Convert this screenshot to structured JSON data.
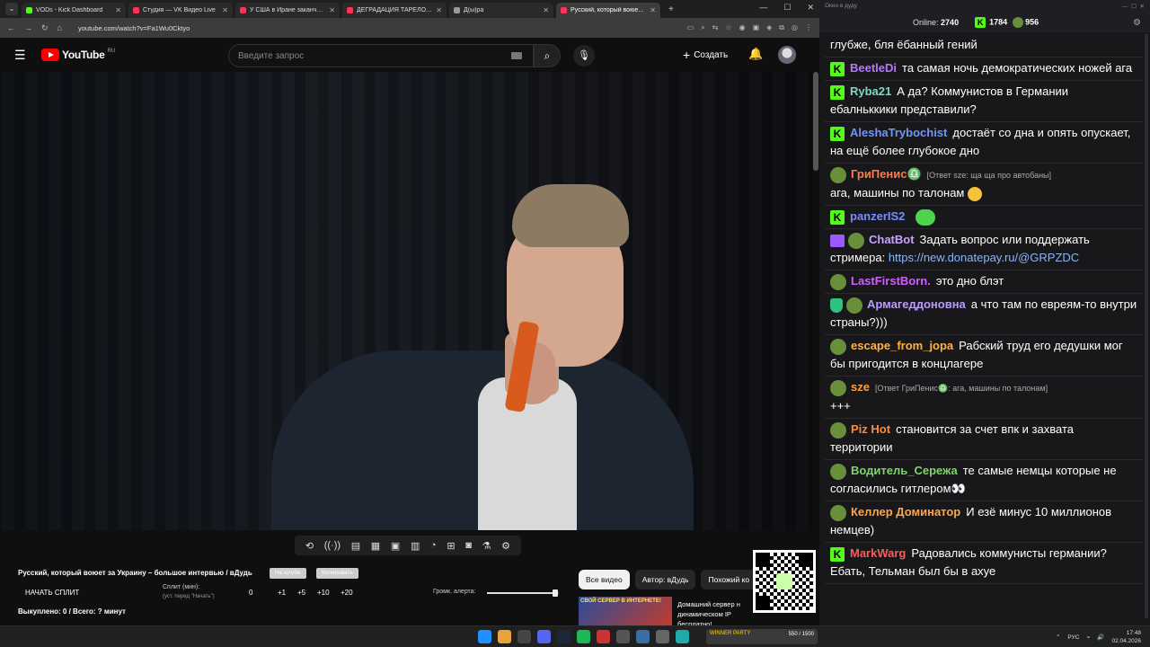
{
  "browser": {
    "tabs": [
      {
        "title": "VODs - Kick Dashboard",
        "color": "#53fc18",
        "active": false
      },
      {
        "title": "Студия — VK Видео Live",
        "color": "#ff3355",
        "active": false
      },
      {
        "title": "У США в Иране заканчиваютс",
        "color": "#ff3355",
        "active": false
      },
      {
        "title": "ДЕГРАДАЦИЯ ТАРЕЛОЧНИЦ",
        "color": "#ff3355",
        "active": false
      },
      {
        "title": "Д(ы)ра",
        "color": "#999999",
        "active": false
      },
      {
        "title": "Русский, который воюет за",
        "color": "#ff3355",
        "active": true
      }
    ],
    "url": "youtube.com/watch?v=Fa1Wu0Cktyo"
  },
  "youtube": {
    "logo_word": "YouTube",
    "logo_region": "RU",
    "search_placeholder": "Введите запрос",
    "create_label": "Создать"
  },
  "video": {
    "title": "Русский, который воюет за Украину – большое интервью / вДудь",
    "btn_on_youtube": "На ютубе",
    "btn_copy": "Копировать",
    "split_button": "НАЧАТЬ СПЛИТ",
    "split_label": "Сплит (мин):",
    "split_sub": "(уст. перед \"Начать\")",
    "split_values": [
      "0",
      "+1",
      "+5",
      "+10",
      "+20"
    ],
    "bought_text": "Выкуплено: 0 / Всего: ? минут",
    "alert_label": "Громк. алерта:",
    "alert_volume": 0.95
  },
  "recs": {
    "chips": [
      "Все видео",
      "Автор: вДудь",
      "Похожий ко"
    ],
    "thumb_text": "СВОЙ СЕРВЕР В ИНТЕРНЕТЕ!",
    "title": "Домашний сервер н динамическом IP бесплатно!..."
  },
  "chat": {
    "window_title": "Окно в дуду",
    "online_label": "Online:",
    "online_count": "2740",
    "kick_count": "1784",
    "other_count": "956",
    "messages": [
      {
        "badge": "none",
        "user": "",
        "color": "#ffffff",
        "reply": "",
        "text": "глубже, бля ёбанный гений"
      },
      {
        "badge": "kick",
        "user": "BeetleDi",
        "color": "#b478ff",
        "reply": "",
        "text": "та самая ночь демократических ножей ага"
      },
      {
        "badge": "kick",
        "user": "Ryba21",
        "color": "#7fd6c9",
        "reply": "",
        "text": "А да? Коммунистов в Германии ебалньккики представили?"
      },
      {
        "badge": "kick",
        "user": "AleshaTrybochist",
        "color": "#6f95ff",
        "reply": "",
        "text": "достаёт со дна и опять опускает, на ещё более глубокое дно"
      },
      {
        "badge": "frog",
        "user": "ГриПенис♎",
        "color": "#ff7b4a",
        "reply": "[Ответ sze: ща ща про автобаны]",
        "text": "ага, машины по талонам"
      },
      {
        "badge": "kick",
        "user": "panzerIS2",
        "color": "#7a8cff",
        "reply": "",
        "text": ""
      },
      {
        "badge": "invader",
        "user": "ChatBot",
        "color": "#c9a2ff",
        "reply": "",
        "text": "Задать вопрос или поддержать стримера:",
        "link": "https://new.donatepay.ru/@GRPZDC"
      },
      {
        "badge": "frog",
        "user": "LastFirstBorn.",
        "color": "#d15dff",
        "reply": "",
        "text": "это дно блэт"
      },
      {
        "badge": "shield",
        "user": "Армагеддоновна",
        "color": "#b79cff",
        "reply": "",
        "text": "а что там по евреям-то внутри страны?)))"
      },
      {
        "badge": "frog",
        "user": "escape_from_jopa",
        "color": "#ffb347",
        "reply": "",
        "text": "Рабский труд его дедушки мог бы пригодится в концлагере"
      },
      {
        "badge": "frog",
        "user": "sze",
        "color": "#ff9e3d",
        "reply": "[Ответ ГриПенис♎: ага, машины по талонам]",
        "text": "+++"
      },
      {
        "badge": "frog",
        "user": "Piz Hot",
        "color": "#ff8a3d",
        "reply": "",
        "text": "становится за счет впк и захвата территории"
      },
      {
        "badge": "frog",
        "user": "Водитель_Сережа",
        "color": "#7fd66a",
        "reply": "",
        "text": "те самые немцы которые не согласились гитлером👀"
      },
      {
        "badge": "frog",
        "user": "Келлер Доминатор",
        "color": "#ffa64d",
        "reply": "",
        "text": "И езё минус 10 миллионов немцев)"
      },
      {
        "badge": "kick",
        "user": "MarkWarg",
        "color": "#ff5a5a",
        "reply": "",
        "text": "Радовались коммунисты германии? Ебать, Тельман был бы в ахуе"
      }
    ]
  },
  "taskbar": {
    "widget_text": "WINNER PARTY",
    "widget_count": "550 / 1500",
    "lang": "РУС",
    "time": "17:48",
    "date": "02.04.2026"
  }
}
